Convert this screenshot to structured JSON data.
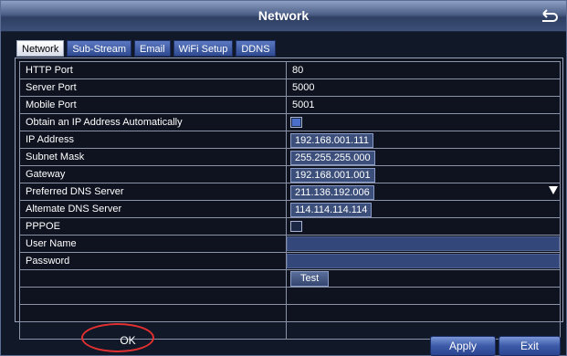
{
  "window": {
    "title": "Network"
  },
  "tabs": [
    {
      "label": "Network",
      "active": true
    },
    {
      "label": "Sub-Stream",
      "active": false
    },
    {
      "label": "Email",
      "active": false
    },
    {
      "label": "WiFi Setup",
      "active": false
    },
    {
      "label": "DDNS",
      "active": false
    }
  ],
  "form": {
    "http_port": {
      "label": "HTTP Port",
      "value": "80"
    },
    "server_port": {
      "label": "Server Port",
      "value": "5000"
    },
    "mobile_port": {
      "label": "Mobile Port",
      "value": "5001"
    },
    "auto_ip": {
      "label": "Obtain an IP Address Automatically",
      "checked": true
    },
    "ip_address": {
      "label": "IP Address",
      "value": "192.168.001.111"
    },
    "subnet_mask": {
      "label": "Subnet Mask",
      "value": "255.255.255.000"
    },
    "gateway": {
      "label": "Gateway",
      "value": "192.168.001.001"
    },
    "preferred_dns": {
      "label": "Preferred DNS Server",
      "value": "211.136.192.006"
    },
    "alternate_dns": {
      "label": "Altemate DNS Server",
      "value": "114.114.114.114"
    },
    "pppoe": {
      "label": "PPPOE",
      "checked": false
    },
    "user_name": {
      "label": "User Name",
      "value": ""
    },
    "password": {
      "label": "Password",
      "value": ""
    },
    "test_label": "Test"
  },
  "footer": {
    "ok_label": "OK",
    "apply_label": "Apply",
    "exit_label": "Exit"
  }
}
